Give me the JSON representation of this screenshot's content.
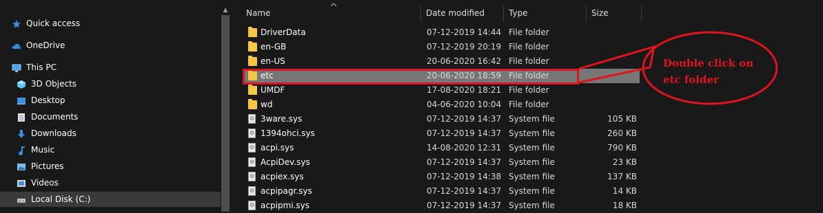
{
  "nav": {
    "items": [
      {
        "label": "Quick access",
        "icon": "star-icon"
      },
      {
        "label": "OneDrive",
        "icon": "cloud-icon"
      },
      {
        "label": "This PC",
        "icon": "monitor-icon"
      },
      {
        "label": "3D Objects",
        "icon": "cube-icon"
      },
      {
        "label": "Desktop",
        "icon": "desktop-icon"
      },
      {
        "label": "Documents",
        "icon": "document-icon"
      },
      {
        "label": "Downloads",
        "icon": "download-icon"
      },
      {
        "label": "Music",
        "icon": "music-icon"
      },
      {
        "label": "Pictures",
        "icon": "picture-icon"
      },
      {
        "label": "Videos",
        "icon": "video-icon"
      },
      {
        "label": "Local Disk (C:)",
        "icon": "drive-icon"
      }
    ]
  },
  "columns": {
    "name": "Name",
    "date": "Date modified",
    "type": "Type",
    "size": "Size"
  },
  "files": [
    {
      "name": "DriverData",
      "date": "07-12-2019 14:44",
      "type": "File folder",
      "size": "",
      "kind": "folder"
    },
    {
      "name": "en-GB",
      "date": "07-12-2019 20:19",
      "type": "File folder",
      "size": "",
      "kind": "folder"
    },
    {
      "name": "en-US",
      "date": "20-06-2020 16:42",
      "type": "File folder",
      "size": "",
      "kind": "folder"
    },
    {
      "name": "etc",
      "date": "20-06-2020 18:59",
      "type": "File folder",
      "size": "",
      "kind": "folder",
      "selected": true
    },
    {
      "name": "UMDF",
      "date": "17-08-2020 18:21",
      "type": "File folder",
      "size": "",
      "kind": "folder"
    },
    {
      "name": "wd",
      "date": "04-06-2020 10:04",
      "type": "File folder",
      "size": "",
      "kind": "folder"
    },
    {
      "name": "3ware.sys",
      "date": "07-12-2019 14:37",
      "type": "System file",
      "size": "105 KB",
      "kind": "sys"
    },
    {
      "name": "1394ohci.sys",
      "date": "07-12-2019 14:37",
      "type": "System file",
      "size": "260 KB",
      "kind": "sys"
    },
    {
      "name": "acpi.sys",
      "date": "14-08-2020 12:31",
      "type": "System file",
      "size": "790 KB",
      "kind": "sys"
    },
    {
      "name": "AcpiDev.sys",
      "date": "07-12-2019 14:37",
      "type": "System file",
      "size": "23 KB",
      "kind": "sys"
    },
    {
      "name": "acpiex.sys",
      "date": "07-12-2019 14:38",
      "type": "System file",
      "size": "137 KB",
      "kind": "sys"
    },
    {
      "name": "acpipagr.sys",
      "date": "07-12-2019 14:37",
      "type": "System file",
      "size": "14 KB",
      "kind": "sys"
    },
    {
      "name": "acpipmi.sys",
      "date": "07-12-2019 14:37",
      "type": "System file",
      "size": "18 KB",
      "kind": "sys"
    }
  ],
  "annotation": {
    "line1": "Double click on",
    "line2": "etc folder",
    "color": "#e0141e"
  },
  "colors": {
    "background": "#191919",
    "selected_row": "#777777",
    "folder": "#f4c846"
  }
}
